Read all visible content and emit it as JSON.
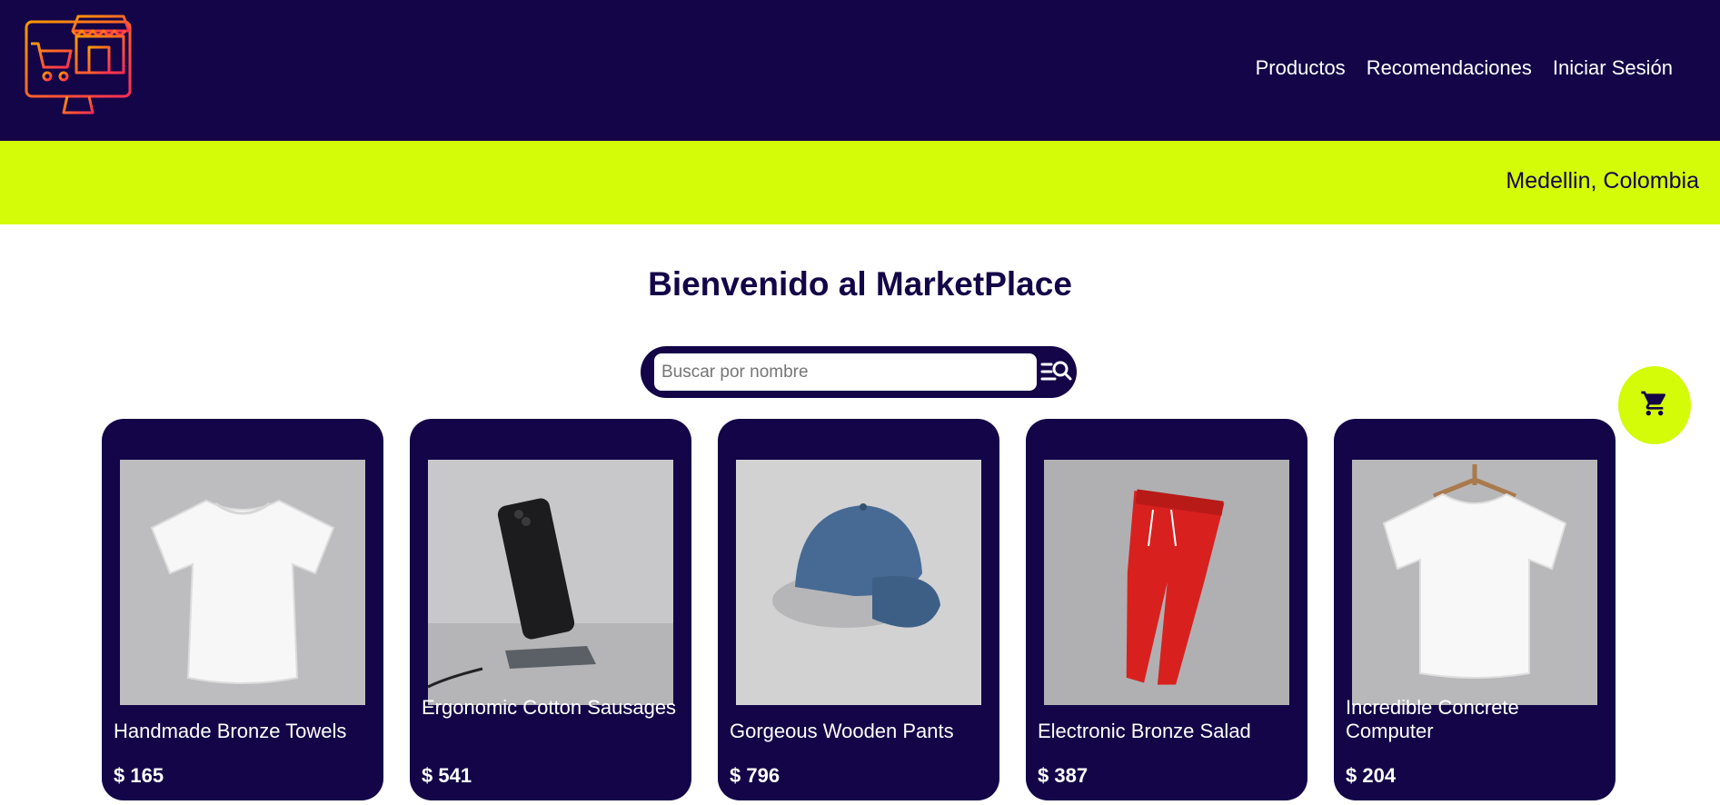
{
  "header": {
    "logo_icon": "storefront-monitor-icon",
    "nav": [
      {
        "label": "Productos"
      },
      {
        "label": "Recomendaciones"
      },
      {
        "label": "Iniciar Sesión"
      }
    ]
  },
  "location_bar": {
    "location": "Medellin, Colombia"
  },
  "main": {
    "title": "Bienvenido al MarketPlace",
    "search": {
      "placeholder": "Buscar por nombre",
      "value": "",
      "icon": "search-filter-icon"
    },
    "cart_icon": "shopping-cart-icon"
  },
  "products": [
    {
      "name": "Handmade Bronze Towels",
      "price": "$ 165",
      "image": "white-tshirt"
    },
    {
      "name": "Ergonomic Cotton Sausages",
      "price": "$ 541",
      "image": "phone-on-charger"
    },
    {
      "name": "Gorgeous Wooden Pants",
      "price": "$ 796",
      "image": "blue-cap"
    },
    {
      "name": "Electronic Bronze Salad",
      "price": "$ 387",
      "image": "red-joggers"
    },
    {
      "name": "Incredible Concrete Computer",
      "price": "$ 204",
      "image": "white-tshirt-on-hanger"
    }
  ],
  "colors": {
    "primary": "#130548",
    "accent": "#d4fb07",
    "logo_gradient": [
      "#ff2d55",
      "#ff9a00"
    ]
  }
}
